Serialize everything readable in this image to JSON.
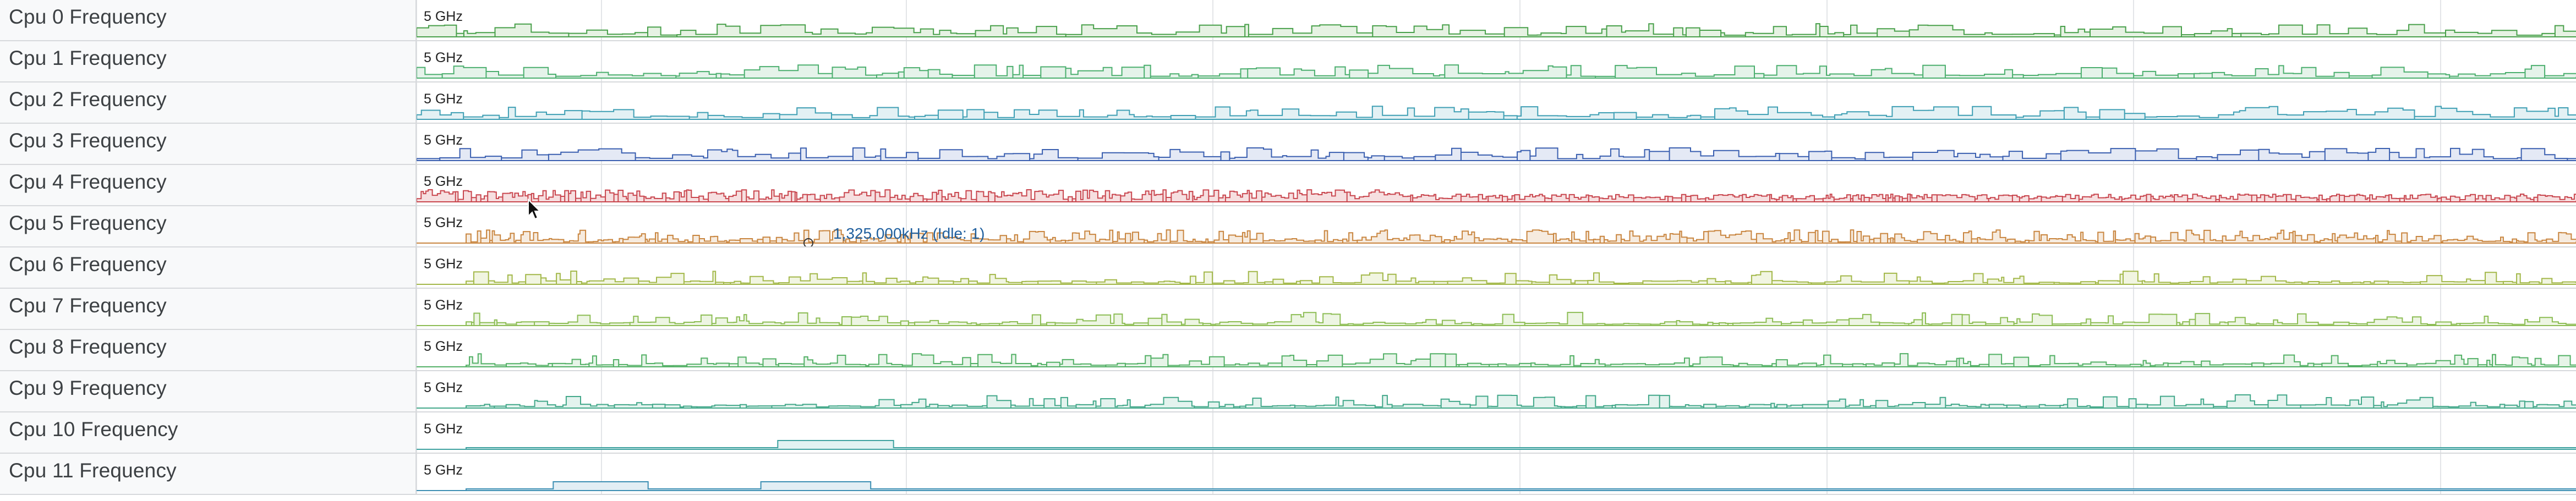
{
  "scale_label": "5 GHz",
  "tracks": [
    {
      "title": "Cpu 0 Frequency",
      "color": "#49a04b",
      "fill": "#e6f2e3",
      "pattern": "blocky"
    },
    {
      "title": "Cpu 1 Frequency",
      "color": "#4caf6f",
      "fill": "#e5f3ea",
      "pattern": "blocky"
    },
    {
      "title": "Cpu 2 Frequency",
      "color": "#3f9fb4",
      "fill": "#e3f1f4",
      "pattern": "blocky"
    },
    {
      "title": "Cpu 3 Frequency",
      "color": "#3a5fb0",
      "fill": "#e4e9f5",
      "pattern": "blocky"
    },
    {
      "title": "Cpu 4 Frequency",
      "color": "#c9474f",
      "fill": "#f6dfe0",
      "pattern": "dense"
    },
    {
      "title": "Cpu 5 Frequency",
      "color": "#c98640",
      "fill": "#f6ebdf",
      "pattern": "dense-light"
    },
    {
      "title": "Cpu 6 Frequency",
      "color": "#a3b84a",
      "fill": "#f1f5e1",
      "pattern": "spiky"
    },
    {
      "title": "Cpu 7 Frequency",
      "color": "#8dbd55",
      "fill": "#edf5e3",
      "pattern": "spiky"
    },
    {
      "title": "Cpu 8 Frequency",
      "color": "#53b066",
      "fill": "#e6f4e8",
      "pattern": "spiky"
    },
    {
      "title": "Cpu 9 Frequency",
      "color": "#43a88a",
      "fill": "#e3f3ee",
      "pattern": "spiky"
    },
    {
      "title": "Cpu 10 Frequency",
      "color": "#3fa2a0",
      "fill": "#e2f2f2",
      "pattern": "flat"
    },
    {
      "title": "Cpu 11 Frequency",
      "color": "#3d8fb3",
      "fill": "#e2eef4",
      "pattern": "flat"
    }
  ],
  "tooltip": {
    "text": "1,325,000kHz (Idle: 1)",
    "color": "#1f5f9e"
  },
  "icons": {
    "cursor": "mouse-pointer-icon",
    "hover_marker": "hover-marker-icon"
  }
}
